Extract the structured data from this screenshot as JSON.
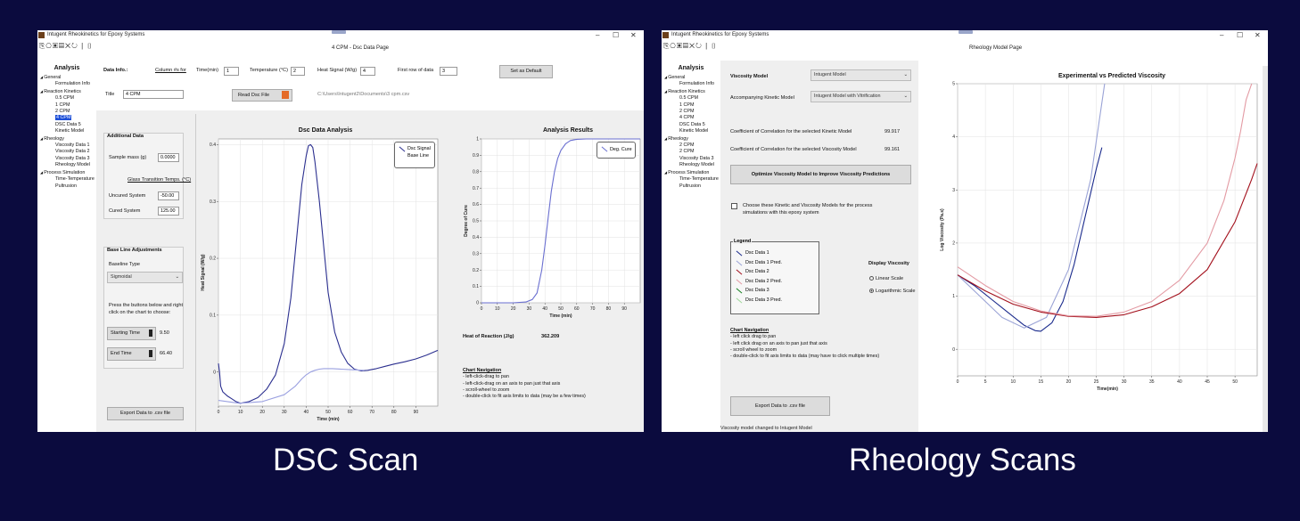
{
  "dsc": {
    "app_title": "Intugent Rheokinetics for Epoxy Systems",
    "page_title": "4 CPM - Dsc Data Page",
    "window_controls": {
      "minimize": "–",
      "maximize": "☐",
      "close": "✕"
    },
    "toolbar_icons": [
      "new-file-icon",
      "open-icon",
      "save-icon",
      "save-as-icon",
      "close-icon",
      "refresh-icon",
      "help-icon"
    ],
    "sidebar": {
      "heading": "Analysis",
      "items": [
        {
          "label": "General",
          "level": 0,
          "caret": "◢"
        },
        {
          "label": "Formulation Info",
          "level": 1
        },
        {
          "label": "Reaction Kinetics",
          "level": 0,
          "caret": "◢"
        },
        {
          "label": "0.5 CPM",
          "level": 1
        },
        {
          "label": "1 CPM",
          "level": 1
        },
        {
          "label": "2 CPM",
          "level": 1
        },
        {
          "label": "4 CPM",
          "level": 1,
          "selected": true
        },
        {
          "label": "DSC Data 5",
          "level": 1
        },
        {
          "label": "Kinetic Model",
          "level": 1
        },
        {
          "label": "Rheology",
          "level": 0,
          "caret": "◢"
        },
        {
          "label": "Viscosity Data 1",
          "level": 1
        },
        {
          "label": "Viscosity Data 2",
          "level": 1
        },
        {
          "label": "Viscosity Data 3",
          "level": 1
        },
        {
          "label": "Rheology Model",
          "level": 1
        },
        {
          "label": "Process Simulation",
          "level": 0,
          "caret": "◢"
        },
        {
          "label": "Time-Temperature",
          "level": 1
        },
        {
          "label": "Pultrusion",
          "level": 1
        }
      ]
    },
    "data_info": {
      "label": "Data Info.:",
      "column_label": "Column #s for",
      "time_label": "Time(min)",
      "time_value": "1",
      "temp_label": "Temperature (°C)",
      "temp_value": "2",
      "heat_label": "Heat Signal (W/g)",
      "heat_value": "4",
      "first_row_label": "First row of data",
      "first_row_value": "3",
      "set_default_button": "Set as Default",
      "title_label": "Title",
      "title_value": "4 CPM",
      "read_button": "Read Dsc File",
      "file_path": "C:\\Users\\Intugent2\\Documents\\3 cpm.csv"
    },
    "additional": {
      "heading": "Additional Data",
      "mass_label": "Sample mass (g)",
      "mass_value": "0.0000",
      "glass_label": "Glass Transition Temps. (°C)",
      "uncured_label": "Uncured System",
      "uncured_value": "-50.00",
      "cured_label": "Cured System",
      "cured_value": "125.00"
    },
    "baseline": {
      "heading": "Base Line Adjustments",
      "type_label": "Baseline Type",
      "type_value": "Sigmoidal",
      "instructions_1": "Press the buttons below and right",
      "instructions_2": "click on the chart to choose:",
      "start_button": "Starting Time",
      "start_value": "9.50",
      "end_button": "End Time",
      "end_value": "66.40"
    },
    "export_button": "Export Data to .csv file",
    "results": {
      "heat_label": "Heat of Reaction (J/g)",
      "heat_value": "362.209"
    },
    "navigation": {
      "heading": "Chart Navigation",
      "lines": [
        "- left-click-drag to pan",
        "- left-click-drag on an axis to pan just that axis",
        "- scroll-wheel to zoom",
        "- double-click to fit axis limits to data (may be a few times)"
      ]
    }
  },
  "rheo": {
    "app_title": "Intugent Rheokinetics for Epoxy Systems",
    "page_title": "Rheology Model Page",
    "window_controls": {
      "minimize": "–",
      "maximize": "☐",
      "close": "✕"
    },
    "toolbar_icons": [
      "new-file-icon",
      "open-icon",
      "save-icon",
      "save-as-icon",
      "close-icon",
      "refresh-icon",
      "help-icon"
    ],
    "sidebar": {
      "heading": "Analysis",
      "items": [
        {
          "label": "General",
          "level": 0,
          "caret": "◢"
        },
        {
          "label": "Formulation Info",
          "level": 1
        },
        {
          "label": "Reaction Kinetics",
          "level": 0,
          "caret": "◢"
        },
        {
          "label": "0.5 CPM",
          "level": 1
        },
        {
          "label": "1 CPM",
          "level": 1
        },
        {
          "label": "2 CPM",
          "level": 1
        },
        {
          "label": "4 CPM",
          "level": 1
        },
        {
          "label": "DSC Data 5",
          "level": 1
        },
        {
          "label": "Kinetic Model",
          "level": 1
        },
        {
          "label": "Rheology",
          "level": 0,
          "caret": "◢"
        },
        {
          "label": "2 CPM",
          "level": 1
        },
        {
          "label": "2 CPM",
          "level": 1
        },
        {
          "label": "Viscosity Data 3",
          "level": 1
        },
        {
          "label": "Rheology Model",
          "level": 1
        },
        {
          "label": "Process Simulation",
          "level": 0,
          "caret": "◢"
        },
        {
          "label": "Time-Temperature",
          "level": 1
        },
        {
          "label": "Pultrusion",
          "level": 1
        }
      ]
    },
    "viscosity_model_label": "Viscosity Model",
    "viscosity_model_value": "Intugent Model",
    "kinetic_model_label": "Accompanying Kinetic Model",
    "kinetic_model_value": "Intugent Model with Vitrification",
    "corr_kinetic_label": "Coefficient of Correlation for the selected Kinetic Model",
    "corr_kinetic_value": "99.917",
    "corr_visc_label": "Coefficient of Correlation for the selected Viscosity Model",
    "corr_visc_value": "99.161",
    "optimize_button": "Optimize Viscosity Model to Improve Viscosity Predictions",
    "choose_line_1": "Choose these Kinetic and Viscosity Models for the process",
    "choose_line_2": "simulations with this epoxy system",
    "legend": {
      "heading": "Legend",
      "items": [
        {
          "label": "Dsc Data 1",
          "color": "#1a2a8c"
        },
        {
          "label": "Dsc Data 1 Pred.",
          "color": "#9aa3d6"
        },
        {
          "label": "Dsc Data 2",
          "color": "#a3101c"
        },
        {
          "label": "Dsc Data 2 Pred.",
          "color": "#e39aa3"
        },
        {
          "label": "Dsc Data 3",
          "color": "#14801e"
        },
        {
          "label": "Dsc Data 3 Pred.",
          "color": "#9fd79a"
        }
      ]
    },
    "display": {
      "heading": "Display Viscosity",
      "linear": "Linear Scale",
      "log": "Logarithmic Scale"
    },
    "navigation": {
      "heading": "Chart Navigation",
      "lines": [
        "- left click drag to pan",
        "- left click drag on an axis to pan just that axis",
        "- scroll wheel to zoom",
        "- double-click to fit axis limits to data (may have to click multiple times)"
      ]
    },
    "export_button": "Export Data to .csv file",
    "status": "Viscosity model changed to Intugent Model"
  },
  "captions": {
    "left": "DSC Scan",
    "right": "Rheology Scans"
  },
  "chart_data": [
    {
      "type": "line",
      "title": "Dsc Data Analysis",
      "xlabel": "Time (min)",
      "ylabel": "Heat Signal (W/g)",
      "xlim": [
        0,
        100
      ],
      "ylim": [
        -0.06,
        0.41
      ],
      "xticks": [
        0,
        10,
        20,
        30,
        40,
        50,
        60,
        70,
        80,
        90
      ],
      "yticks": [
        0,
        0.1,
        0.2,
        0.3,
        0.4
      ],
      "legend_position": "top-right",
      "series": [
        {
          "name": "Dsc Signal",
          "color": "#2b2f8f",
          "x": [
            0,
            0.5,
            1,
            2,
            4,
            6,
            8,
            10,
            14,
            18,
            22,
            26,
            30,
            33,
            36,
            38,
            40,
            41,
            42,
            43,
            44,
            46,
            48,
            50,
            53,
            56,
            59,
            62,
            65,
            68,
            72,
            76,
            80,
            85,
            90,
            95,
            100
          ],
          "y": [
            0.015,
            0.0,
            -0.025,
            -0.035,
            -0.042,
            -0.047,
            -0.052,
            -0.055,
            -0.052,
            -0.045,
            -0.03,
            -0.005,
            0.05,
            0.13,
            0.25,
            0.33,
            0.38,
            0.398,
            0.4,
            0.395,
            0.37,
            0.3,
            0.22,
            0.14,
            0.07,
            0.035,
            0.015,
            0.005,
            0.002,
            0.003,
            0.006,
            0.01,
            0.014,
            0.018,
            0.023,
            0.03,
            0.038
          ]
        },
        {
          "name": "Base Line",
          "color": "#9aa0e0",
          "x": [
            0,
            9.5,
            20,
            30,
            35,
            38,
            40,
            42,
            44,
            46,
            48,
            52,
            56,
            60,
            66.4
          ],
          "y": [
            -0.05,
            -0.055,
            -0.052,
            -0.04,
            -0.025,
            -0.012,
            -0.005,
            0.0,
            0.003,
            0.005,
            0.006,
            0.006,
            0.005,
            0.004,
            0.003
          ]
        }
      ]
    },
    {
      "type": "line",
      "title": "Analysis Results",
      "xlabel": "Time (min)",
      "ylabel": "Degree of Cure",
      "xlim": [
        0,
        100
      ],
      "ylim": [
        0,
        1
      ],
      "xticks": [
        0,
        10,
        20,
        30,
        40,
        50,
        60,
        70,
        80,
        90
      ],
      "yticks": [
        0,
        0.1,
        0.2,
        0.3,
        0.4,
        0.5,
        0.6,
        0.7,
        0.8,
        0.9,
        1
      ],
      "legend_position": "top-right",
      "series": [
        {
          "name": "Deg. Cure",
          "color": "#6a6fd0",
          "x": [
            0,
            20,
            28,
            32,
            35,
            38,
            40,
            42,
            44,
            46,
            48,
            50,
            53,
            56,
            60,
            66,
            100
          ],
          "y": [
            0,
            0,
            0.005,
            0.02,
            0.06,
            0.2,
            0.35,
            0.52,
            0.68,
            0.8,
            0.88,
            0.93,
            0.97,
            0.99,
            0.998,
            1,
            1
          ]
        }
      ]
    },
    {
      "type": "line",
      "title": "Experimental vs Predicted Viscosity",
      "xlabel": "Time(min)",
      "ylabel": "Log Viscosity (Pa.s)",
      "xlim": [
        0,
        54
      ],
      "ylim": [
        -0.5,
        5
      ],
      "xticks": [
        0,
        5,
        10,
        15,
        20,
        25,
        30,
        35,
        40,
        45,
        50
      ],
      "yticks": [
        0,
        1,
        2,
        3,
        4,
        5
      ],
      "series": [
        {
          "color": "#1a2a8c",
          "x": [
            0,
            3,
            6,
            9,
            12,
            14,
            15,
            17,
            19,
            21,
            23,
            25,
            26
          ],
          "y": [
            1.4,
            1.2,
            0.95,
            0.7,
            0.45,
            0.35,
            0.34,
            0.5,
            0.9,
            1.6,
            2.5,
            3.4,
            3.8
          ]
        },
        {
          "color": "#9aa3d6",
          "x": [
            0,
            4,
            8,
            12,
            16,
            20,
            24,
            26.5
          ],
          "y": [
            1.4,
            1.0,
            0.6,
            0.4,
            0.6,
            1.5,
            3.2,
            5
          ]
        },
        {
          "color": "#a3101c",
          "x": [
            0,
            5,
            10,
            15,
            20,
            25,
            30,
            35,
            40,
            45,
            50,
            53,
            54
          ],
          "y": [
            1.4,
            1.1,
            0.85,
            0.7,
            0.62,
            0.6,
            0.65,
            0.8,
            1.05,
            1.5,
            2.4,
            3.2,
            3.5
          ]
        },
        {
          "color": "#e39aa3",
          "x": [
            0,
            5,
            10,
            15,
            20,
            25,
            30,
            35,
            40,
            45,
            48,
            50,
            51,
            52,
            53
          ],
          "y": [
            1.55,
            1.2,
            0.9,
            0.72,
            0.63,
            0.62,
            0.7,
            0.9,
            1.3,
            2.0,
            2.8,
            3.6,
            4.1,
            4.7,
            5
          ]
        }
      ]
    }
  ]
}
